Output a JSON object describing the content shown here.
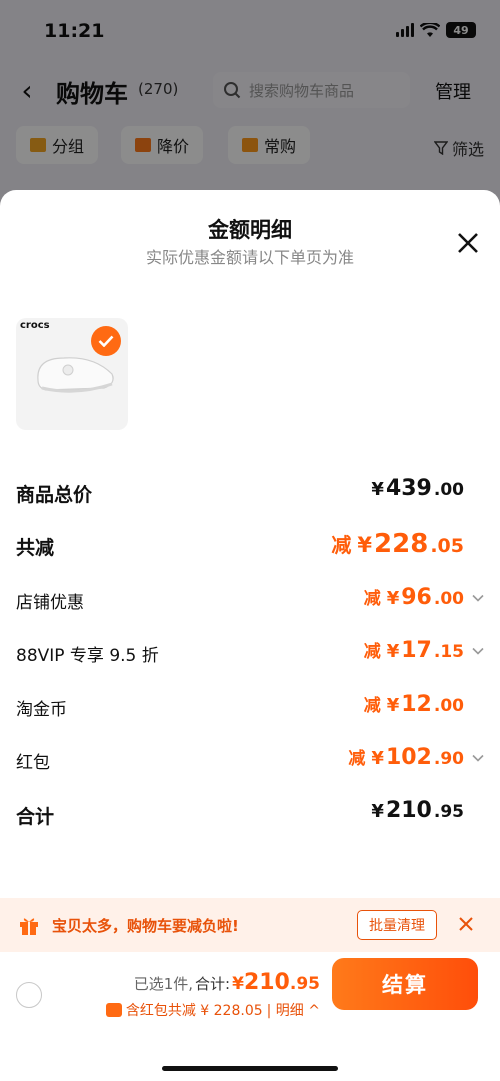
{
  "status": {
    "time": "11:21",
    "battery": "49"
  },
  "nav": {
    "title": "购物车",
    "count": "(270)",
    "search_placeholder": "搜索购物车商品",
    "manage": "管理"
  },
  "filters": {
    "group": "分组",
    "price_drop": "降价",
    "frequent": "常购",
    "filter": "筛选"
  },
  "sheet": {
    "title": "金额明细",
    "subtitle": "实际优惠金额请以下单页为准",
    "product_brand": "crocs",
    "rows": [
      {
        "label": "商品总价",
        "minus": "",
        "yen": "¥",
        "int": "439",
        "dec": ".00",
        "chevron": false
      },
      {
        "label": "共减",
        "minus": "减",
        "yen": "¥",
        "int": "228",
        "dec": ".05",
        "chevron": false
      },
      {
        "label": "店铺优惠",
        "minus": "减",
        "yen": "¥",
        "int": "96",
        "dec": ".00",
        "chevron": true
      },
      {
        "label": "88VIP 专享 9.5 折",
        "minus": "减",
        "yen": "¥",
        "int": "17",
        "dec": ".15",
        "chevron": true
      },
      {
        "label": "淘金币",
        "minus": "减",
        "yen": "¥",
        "int": "12",
        "dec": ".00",
        "chevron": false
      },
      {
        "label": "红包",
        "minus": "减",
        "yen": "¥",
        "int": "102",
        "dec": ".90",
        "chevron": true
      },
      {
        "label": "合计",
        "minus": "",
        "yen": "¥",
        "int": "210",
        "dec": ".95",
        "chevron": false
      }
    ]
  },
  "banner": {
    "text": "宝贝太多，购物车要减负啦!",
    "button": "批量清理"
  },
  "bottom": {
    "selected": "已选1件,",
    "total_label": "合计:",
    "total_yen": "¥",
    "total_int": "210",
    "total_dec": ".95",
    "discount": "含红包共减 ¥ 228.05",
    "detail": "| 明细 ^",
    "checkout": "结算"
  },
  "colors": {
    "accent": "#ff5d0a",
    "banner_bg": "#fff1e9"
  }
}
